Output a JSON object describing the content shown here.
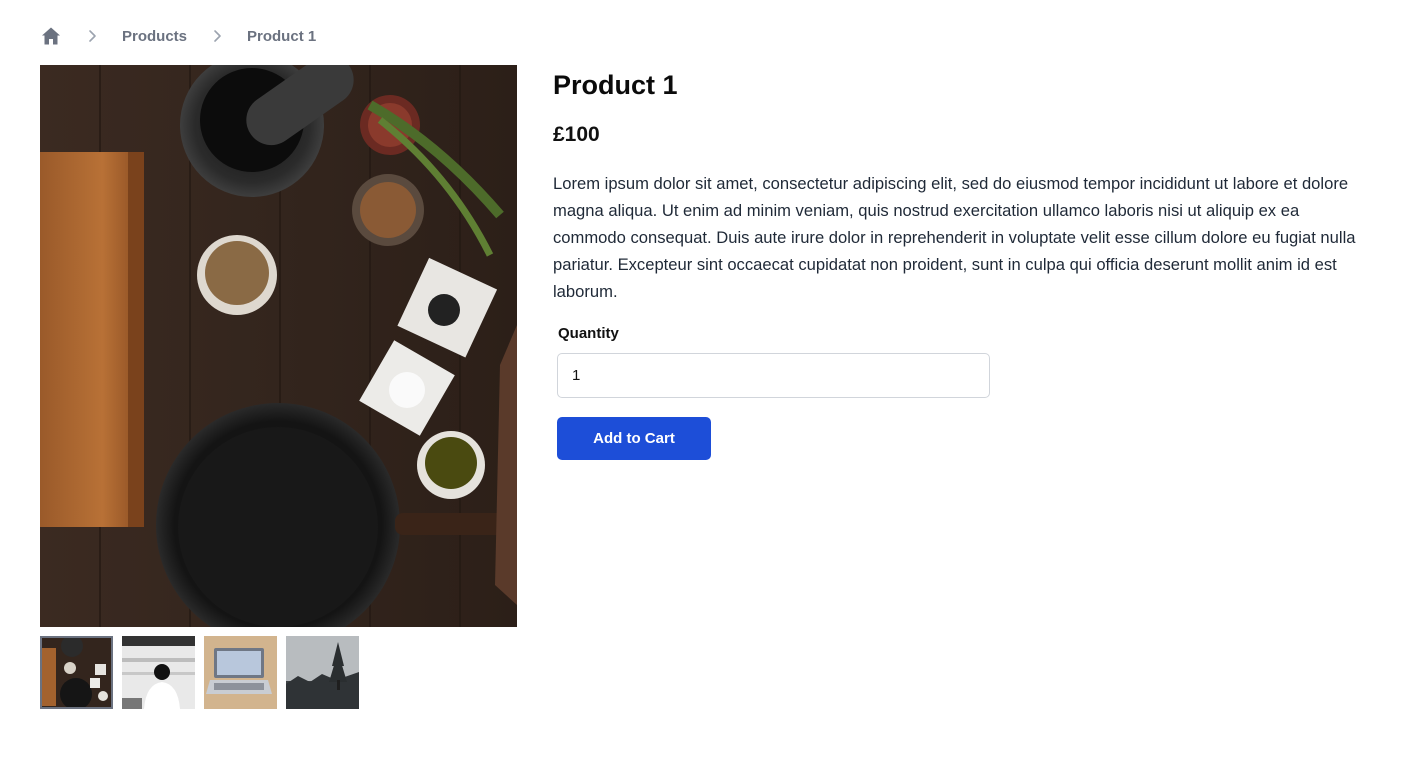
{
  "breadcrumb": {
    "home_icon": "home-icon",
    "separator_icon": "chevron-right-icon",
    "items": [
      "Products",
      "Product 1"
    ]
  },
  "product": {
    "title": "Product 1",
    "price": "£100",
    "description": "Lorem ipsum dolor sit amet, consectetur adipiscing elit, sed do eiusmod tempor incididunt ut labore et dolore magna aliqua. Ut enim ad minim veniam, quis nostrud exercitation ullamco laboris nisi ut aliquip ex ea commodo consequat. Duis aute irure dolor in reprehenderit in voluptate velit esse cillum dolore eu fugiat nulla pariatur. Excepteur sint occaecat cupidatat non proident, sunt in culpa qui officia deserunt mollit anim id est laborum."
  },
  "quantity": {
    "label": "Quantity",
    "value": "1"
  },
  "actions": {
    "add_to_cart": "Add to Cart"
  },
  "colors": {
    "accent": "#1d4ed8",
    "muted_text": "#6b7280",
    "border": "#d1d5db"
  }
}
